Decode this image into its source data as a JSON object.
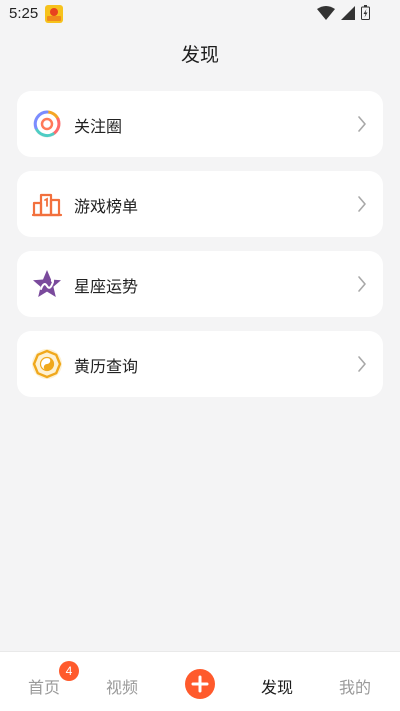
{
  "status_bar": {
    "time": "5:25",
    "icons": [
      "app-notification-icon",
      "wifi-icon",
      "signal-icon",
      "battery-icon"
    ]
  },
  "page": {
    "title": "发现"
  },
  "menu": {
    "items": [
      {
        "label": "关注圈",
        "icon": "follow-circle-icon"
      },
      {
        "label": "游戏榜单",
        "icon": "game-ranking-icon"
      },
      {
        "label": "星座运势",
        "icon": "horoscope-star-icon"
      },
      {
        "label": "黄历查询",
        "icon": "almanac-bagua-icon"
      }
    ]
  },
  "tab_bar": {
    "tabs": [
      {
        "label": "首页",
        "badge": "4",
        "active": false
      },
      {
        "label": "视频",
        "active": false
      },
      {
        "label": "",
        "icon": "add-icon",
        "active": false
      },
      {
        "label": "发现",
        "active": true
      },
      {
        "label": "我的",
        "active": false
      }
    ]
  },
  "colors": {
    "accent": "#ff5a2c",
    "background": "#f4f4f5",
    "card": "#ffffff",
    "text_primary": "#222222",
    "text_inactive": "#9a9a9a"
  }
}
